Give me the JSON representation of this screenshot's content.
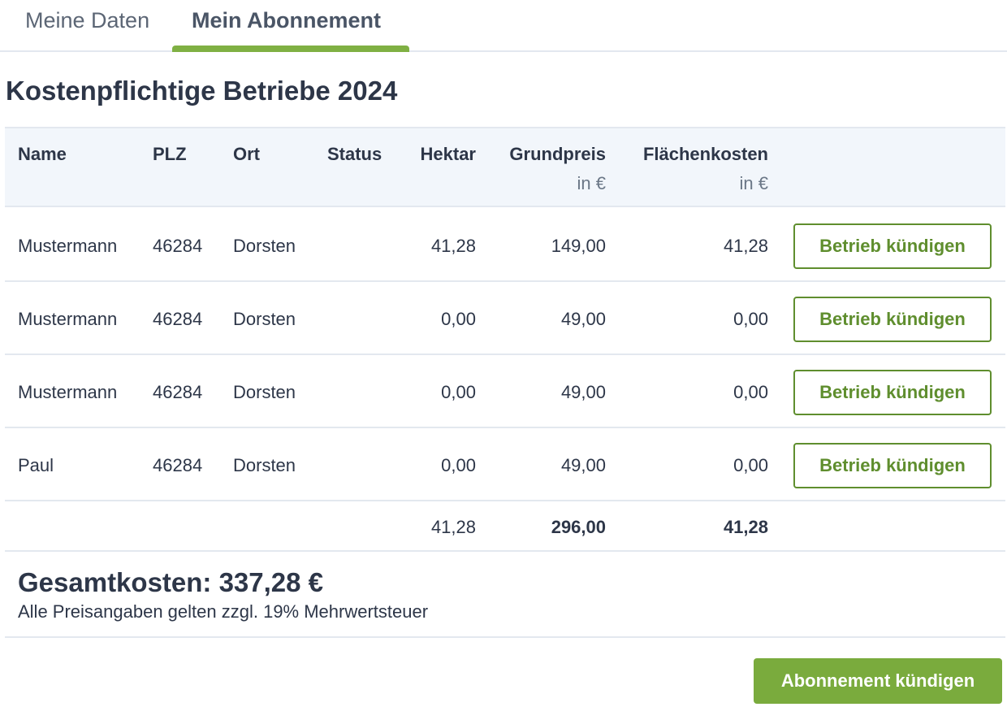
{
  "tabs": [
    {
      "label": "Meine Daten",
      "active": false
    },
    {
      "label": "Mein Abonnement",
      "active": true
    }
  ],
  "colors": {
    "accent": "#7fb043",
    "button_primary": "#7aab3d",
    "button_outline": "#5f8e2e",
    "header_bg": "#f2f6fb",
    "text": "#2d3648"
  },
  "title": "Kostenpflichtige Betriebe 2024",
  "table": {
    "columns": {
      "name": "Name",
      "plz": "PLZ",
      "ort": "Ort",
      "status": "Status",
      "hektar": "Hektar",
      "grundpreis": "Grundpreis",
      "grundpreis_unit": "in €",
      "flaechenkosten": "Flächenkosten",
      "flaechenkosten_unit": "in €"
    },
    "rows": [
      {
        "name": "Mustermann",
        "plz": "46284",
        "ort": "Dorsten",
        "status": "",
        "hektar": "41,28",
        "grundpreis": "149,00",
        "flaechenkosten": "41,28",
        "action": "Betrieb kündigen"
      },
      {
        "name": "Mustermann",
        "plz": "46284",
        "ort": "Dorsten",
        "status": "",
        "hektar": "0,00",
        "grundpreis": "49,00",
        "flaechenkosten": "0,00",
        "action": "Betrieb kündigen"
      },
      {
        "name": "Mustermann",
        "plz": "46284",
        "ort": "Dorsten",
        "status": "",
        "hektar": "0,00",
        "grundpreis": "49,00",
        "flaechenkosten": "0,00",
        "action": "Betrieb kündigen"
      },
      {
        "name": "Paul",
        "plz": "46284",
        "ort": "Dorsten",
        "status": "",
        "hektar": "0,00",
        "grundpreis": "49,00",
        "flaechenkosten": "0,00",
        "action": "Betrieb kündigen"
      }
    ],
    "totals": {
      "hektar": "41,28",
      "grundpreis": "296,00",
      "flaechenkosten": "41,28"
    }
  },
  "summary": {
    "title": "Gesamtkosten: 337,28 €",
    "note": "Alle Preisangaben gelten zzgl. 19% Mehrwertsteuer"
  },
  "cancel_subscription_label": "Abonnement kündigen"
}
